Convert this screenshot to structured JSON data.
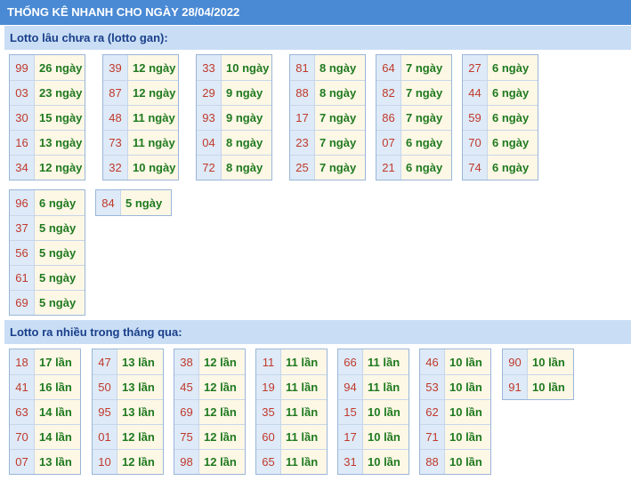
{
  "title": "THỐNG KÊ NHANH CHO NGÀY 28/04/2022",
  "gan": {
    "heading": "Lotto lâu chưa ra (lotto gan):",
    "columns": [
      [
        [
          "99",
          "26 ngày"
        ],
        [
          "03",
          "23 ngày"
        ],
        [
          "30",
          "15 ngày"
        ],
        [
          "16",
          "13 ngày"
        ],
        [
          "34",
          "12 ngày"
        ]
      ],
      [
        [
          "39",
          "12 ngày"
        ],
        [
          "87",
          "12 ngày"
        ],
        [
          "48",
          "11 ngày"
        ],
        [
          "73",
          "11 ngày"
        ],
        [
          "32",
          "10 ngày"
        ]
      ],
      [
        [
          "33",
          "10 ngày"
        ],
        [
          "29",
          "9 ngày"
        ],
        [
          "93",
          "9 ngày"
        ],
        [
          "04",
          "8 ngày"
        ],
        [
          "72",
          "8 ngày"
        ]
      ],
      [
        [
          "81",
          "8 ngày"
        ],
        [
          "88",
          "8 ngày"
        ],
        [
          "17",
          "7 ngày"
        ],
        [
          "23",
          "7 ngày"
        ],
        [
          "25",
          "7 ngày"
        ]
      ],
      [
        [
          "64",
          "7 ngày"
        ],
        [
          "82",
          "7 ngày"
        ],
        [
          "86",
          "7 ngày"
        ],
        [
          "07",
          "6 ngày"
        ],
        [
          "21",
          "6 ngày"
        ]
      ],
      [
        [
          "27",
          "6 ngày"
        ],
        [
          "44",
          "6 ngày"
        ],
        [
          "59",
          "6 ngày"
        ],
        [
          "70",
          "6 ngày"
        ],
        [
          "74",
          "6 ngày"
        ]
      ],
      [
        [
          "96",
          "6 ngày"
        ],
        [
          "37",
          "5 ngày"
        ],
        [
          "56",
          "5 ngày"
        ],
        [
          "61",
          "5 ngày"
        ],
        [
          "69",
          "5 ngày"
        ]
      ],
      [
        [
          "84",
          "5 ngày"
        ]
      ]
    ]
  },
  "nhieu": {
    "heading": "Lotto ra nhiều trong tháng qua:",
    "columns": [
      [
        [
          "18",
          "17 lần"
        ],
        [
          "41",
          "16 lần"
        ],
        [
          "63",
          "14 lần"
        ],
        [
          "70",
          "14 lần"
        ],
        [
          "07",
          "13 lần"
        ]
      ],
      [
        [
          "47",
          "13 lần"
        ],
        [
          "50",
          "13 lần"
        ],
        [
          "95",
          "13 lần"
        ],
        [
          "01",
          "12 lần"
        ],
        [
          "10",
          "12 lần"
        ]
      ],
      [
        [
          "38",
          "12 lần"
        ],
        [
          "45",
          "12 lần"
        ],
        [
          "69",
          "12 lần"
        ],
        [
          "75",
          "12 lần"
        ],
        [
          "98",
          "12 lần"
        ]
      ],
      [
        [
          "11",
          "11 lần"
        ],
        [
          "19",
          "11 lần"
        ],
        [
          "35",
          "11 lần"
        ],
        [
          "60",
          "11 lần"
        ],
        [
          "65",
          "11 lần"
        ]
      ],
      [
        [
          "66",
          "11 lần"
        ],
        [
          "94",
          "11 lần"
        ],
        [
          "15",
          "10 lần"
        ],
        [
          "17",
          "10 lần"
        ],
        [
          "31",
          "10 lần"
        ]
      ],
      [
        [
          "46",
          "10 lần"
        ],
        [
          "53",
          "10 lần"
        ],
        [
          "62",
          "10 lần"
        ],
        [
          "71",
          "10 lần"
        ],
        [
          "88",
          "10 lần"
        ]
      ],
      [
        [
          "90",
          "10 lần"
        ],
        [
          "91",
          "10 lần"
        ]
      ]
    ]
  }
}
